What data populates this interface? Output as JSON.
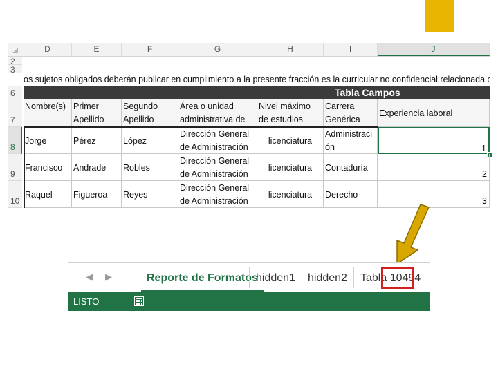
{
  "colors": {
    "accent": "#E8B400",
    "excel_green": "#217346",
    "header_band": "#3b3b3b",
    "highlight_red": "#d21f1f",
    "arrow": "#D9A800"
  },
  "icons": {
    "accent": "yellow-square",
    "arrow": "down-left-arrow",
    "nav_prev": "chevron-left-icon",
    "nav_next": "chevron-right-icon",
    "status": "page-layout-icon"
  },
  "sheet": {
    "columns": [
      "D",
      "E",
      "F",
      "G",
      "H",
      "I",
      "J"
    ],
    "row_numbers": [
      "2",
      "3",
      "6",
      "7",
      "8",
      "9",
      "10"
    ],
    "notice_text": "os sujetos obligados deberán publicar en cumplimiento a la presente fracción es la curricular no confidencial relacionada con todos los(as",
    "band_title": "Tabla Campos",
    "headers": [
      "Nombre(s)",
      "Primer Apellido",
      "Segundo Apellido",
      "Área o unidad administrativa de",
      "Nivel máximo de estudios",
      "Carrera Genérica",
      "Experiencia laboral"
    ],
    "rows": [
      [
        "Jorge",
        "Pérez",
        "López",
        "Dirección General de Administración",
        "licenciatura",
        "Administración",
        "1"
      ],
      [
        "Francisco",
        "Andrade",
        "Robles",
        "Dirección General de Administración",
        "licenciatura",
        "Contaduría",
        "2"
      ],
      [
        "Raquel",
        "Figueroa",
        "Reyes",
        "Dirección General de Administración",
        "licenciatura",
        "Derecho",
        "3"
      ]
    ]
  },
  "tabs": {
    "active": "Reporte de Formatos",
    "hidden1": "hidden1",
    "hidden2": "hidden2",
    "tabla_prefix": "Tabla",
    "tabla_number": "10494"
  },
  "status": {
    "text": "LISTO"
  }
}
